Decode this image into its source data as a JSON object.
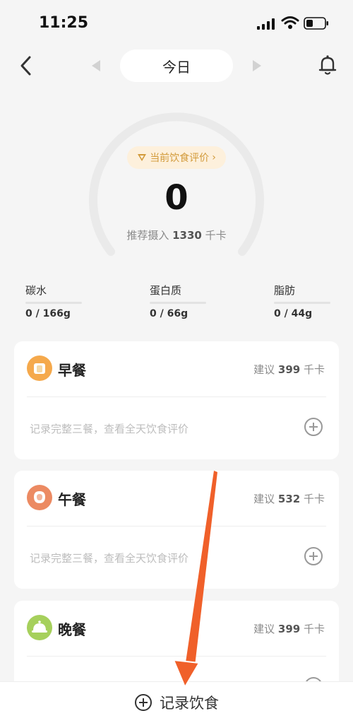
{
  "status_bar": {
    "time": "11:25"
  },
  "nav": {
    "date_label": "今日"
  },
  "summary": {
    "evaluation_label": "当前饮食评价",
    "calorie_value": "0",
    "recommend_prefix": "推荐摄入",
    "recommend_value": "1330",
    "recommend_unit": "千卡",
    "ring_progress": 0
  },
  "macros": [
    {
      "label": "碳水",
      "value": "0 / 166g"
    },
    {
      "label": "蛋白质",
      "value": "0 / 66g"
    },
    {
      "label": "脂肪",
      "value": "0 / 44g"
    }
  ],
  "meals": [
    {
      "name": "早餐",
      "suggest_prefix": "建议",
      "suggest_value": "399",
      "suggest_unit": "千卡",
      "hint": "记录完整三餐，查看全天饮食评价",
      "icon_color": "#f5a94c",
      "icon": "bread-icon"
    },
    {
      "name": "午餐",
      "suggest_prefix": "建议",
      "suggest_value": "532",
      "suggest_unit": "千卡",
      "hint": "记录完整三餐，查看全天饮食评价",
      "icon_color": "#ec8a62",
      "icon": "lunch-icon"
    },
    {
      "name": "晚餐",
      "suggest_prefix": "建议",
      "suggest_value": "399",
      "suggest_unit": "千卡",
      "hint": "",
      "icon_color": "#a6d05c",
      "icon": "dinner-icon"
    }
  ],
  "bottom_bar": {
    "label": "记录饮食"
  },
  "colors": {
    "accent_arrow": "#f0602a",
    "eval_text": "#d29a3a",
    "eval_bg": "#fdf0dc"
  }
}
